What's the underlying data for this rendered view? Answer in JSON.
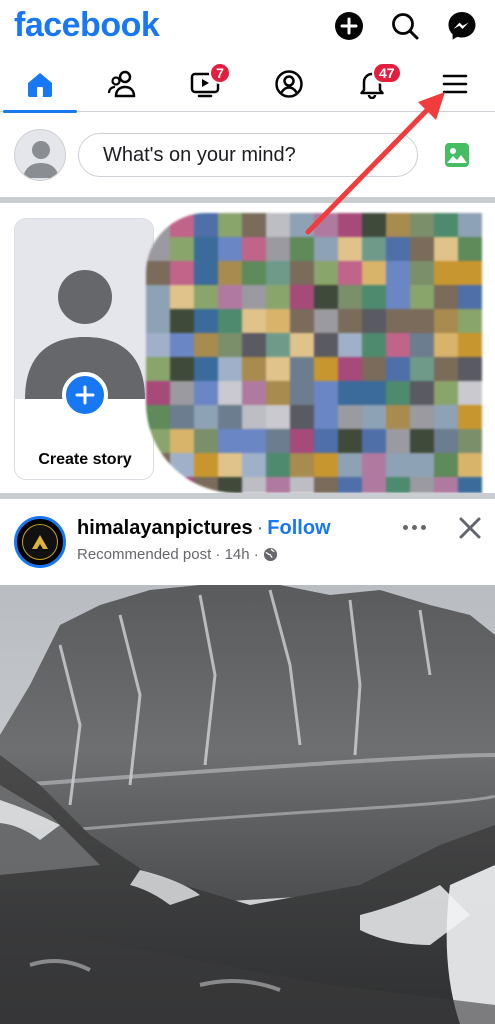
{
  "header": {
    "logo": "facebook",
    "icons": [
      "plus-circle-icon",
      "search-icon",
      "messenger-icon"
    ]
  },
  "nav": {
    "tabs": [
      {
        "name": "home",
        "active": true
      },
      {
        "name": "friends",
        "active": false
      },
      {
        "name": "video",
        "active": false,
        "badge": "7"
      },
      {
        "name": "profile",
        "active": false
      },
      {
        "name": "notifications",
        "active": false,
        "badge": "47"
      },
      {
        "name": "menu",
        "active": false
      }
    ]
  },
  "composer": {
    "placeholder": "What's on your mind?"
  },
  "stories": {
    "create_label": "Create story"
  },
  "post": {
    "author": "himalayanpictures",
    "separator": "·",
    "follow_label": "Follow",
    "meta": "Recommended post · 14h ·"
  },
  "colors": {
    "brand": "#1877f2",
    "badge": "#e41e3f",
    "annotation_arrow": "#f03c3c"
  }
}
